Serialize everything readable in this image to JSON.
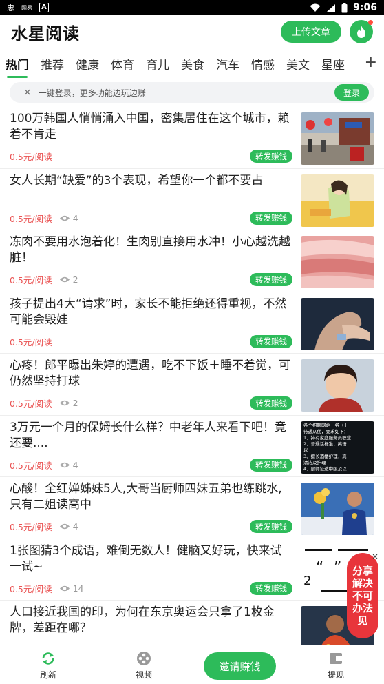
{
  "status_bar": {
    "time": "9:06",
    "app_icon_glyph": "忠",
    "small_text": "网易",
    "box_letter": "A"
  },
  "header": {
    "title": "水星阅读",
    "upload_label": "上传文章",
    "accent": "#2dbb5a"
  },
  "tabs": [
    {
      "label": "热门",
      "active": true
    },
    {
      "label": "推荐"
    },
    {
      "label": "健康"
    },
    {
      "label": "体育"
    },
    {
      "label": "育儿"
    },
    {
      "label": "美食"
    },
    {
      "label": "汽车"
    },
    {
      "label": "情感"
    },
    {
      "label": "美文"
    },
    {
      "label": "星座"
    }
  ],
  "tab_more": "+",
  "login_banner": {
    "close": "×",
    "text": "一键登录，更多功能边玩边赚",
    "button": "登录"
  },
  "news": [
    {
      "title": "100万韩国人悄悄涌入中国，密集居住在这个城市，赖着不肯走",
      "price": "0.5元/阅读",
      "views": "",
      "share": "转发赚钱",
      "thumb": "street-scene"
    },
    {
      "title": "女人长期“缺爱”的3个表现，希望你一个都不要占",
      "price": "0.5元/阅读",
      "views": "4",
      "share": "转发赚钱",
      "thumb": "illustrated-woman"
    },
    {
      "title": "冻肉不要用水泡着化！生肉别直接用水冲！小心越洗越脏！",
      "price": "0.5元/阅读",
      "views": "2",
      "share": "转发赚钱",
      "thumb": "raw-meat"
    },
    {
      "title": "孩子提出4大“请求”时，家长不能拒绝还得重视，不然可能会毁娃",
      "price": "0.5元/阅读",
      "views": "",
      "share": "转发赚钱",
      "thumb": "holding-hands"
    },
    {
      "title": "心疼！郎平曝出朱婷的遭遇，吃不下饭＋睡不着觉，可仍然坚持打球",
      "price": "0.5元/阅读",
      "views": "2",
      "share": "转发赚钱",
      "thumb": "portrait"
    },
    {
      "title": "3万元一个月的保姆长什么样？中老年人来看下吧！竟还要....",
      "price": "0.5元/阅读",
      "views": "4",
      "share": "转发赚钱",
      "thumb": "text-screenshot"
    },
    {
      "title": "心酸！全红婵姊妹5人,大哥当厨师四妹五弟也练跳水,只有二姐读高中",
      "price": "0.5元/阅读",
      "views": "4",
      "share": "转发赚钱",
      "thumb": "podium"
    },
    {
      "title": "1张图猜3个成语，难倒无数人！健脑又好玩，快来试一试~",
      "price": "0.5元/阅读",
      "views": "14",
      "share": "转发赚钱",
      "thumb": "puzzle"
    },
    {
      "title": "人口接近我国的印，为何在东京奥运会只拿了1枚金牌，差距在哪？",
      "price": "",
      "views": "",
      "share": "",
      "thumb": "athlete"
    }
  ],
  "thumb_text_lines": [
    "各个招聘网站一名（上",
    "待遇从优，要求如下：",
    "1、持有家庭服务员职业",
    "2、普通话标准、英语",
    "以上",
    "3、擅长酒楼护理，真",
    "清洁及护理",
    "4、厨师证达中级及以"
  ],
  "puzzle_digit": "2",
  "float_ad": {
    "text": "分享解决不可办法见",
    "close": "×"
  },
  "bottom_nav": {
    "refresh": "刷新",
    "video": "视频",
    "invite": "邀请赚钱",
    "withdraw": "提现"
  }
}
